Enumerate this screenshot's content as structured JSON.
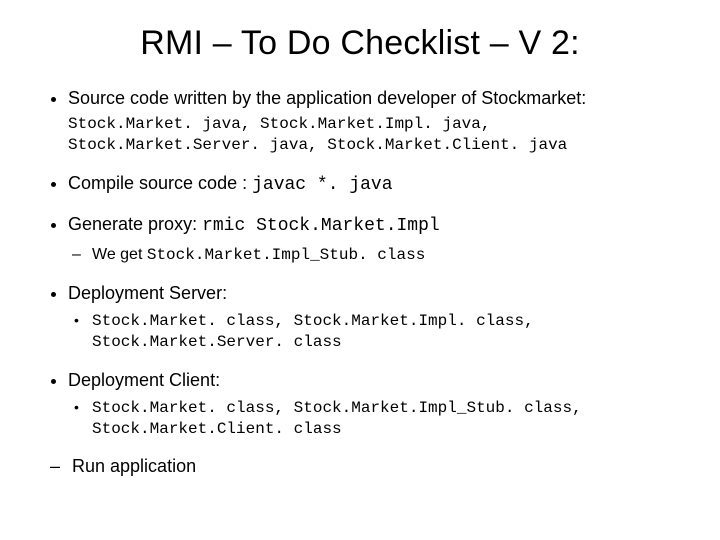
{
  "title": "RMI – To Do Checklist – V 2:",
  "items": [
    {
      "text": "Source code written by the application developer of Stockmarket:",
      "code": "Stock.Market. java, Stock.Market.Impl. java, Stock.Market.Server. java, Stock.Market.Client. java"
    },
    {
      "text_before": "Compile source code : ",
      "mono_after": "javac *. java"
    },
    {
      "text_before": "Generate proxy: ",
      "mono_after": "rmic Stock.Market.Impl",
      "sub": [
        {
          "style": "dash",
          "text_before": "We get ",
          "mono_after": "Stock.Market.Impl_Stub. class"
        }
      ]
    },
    {
      "text": "Deployment Server:",
      "sub": [
        {
          "style": "dot",
          "mono": "Stock.Market. class, Stock.Market.Impl. class, Stock.Market.Server. class"
        }
      ]
    },
    {
      "text": "Deployment Client:",
      "sub": [
        {
          "style": "dot",
          "mono": "Stock.Market. class, Stock.Market.Impl_Stub. class, Stock.Market.Client. class"
        }
      ]
    }
  ],
  "run": "Run application"
}
